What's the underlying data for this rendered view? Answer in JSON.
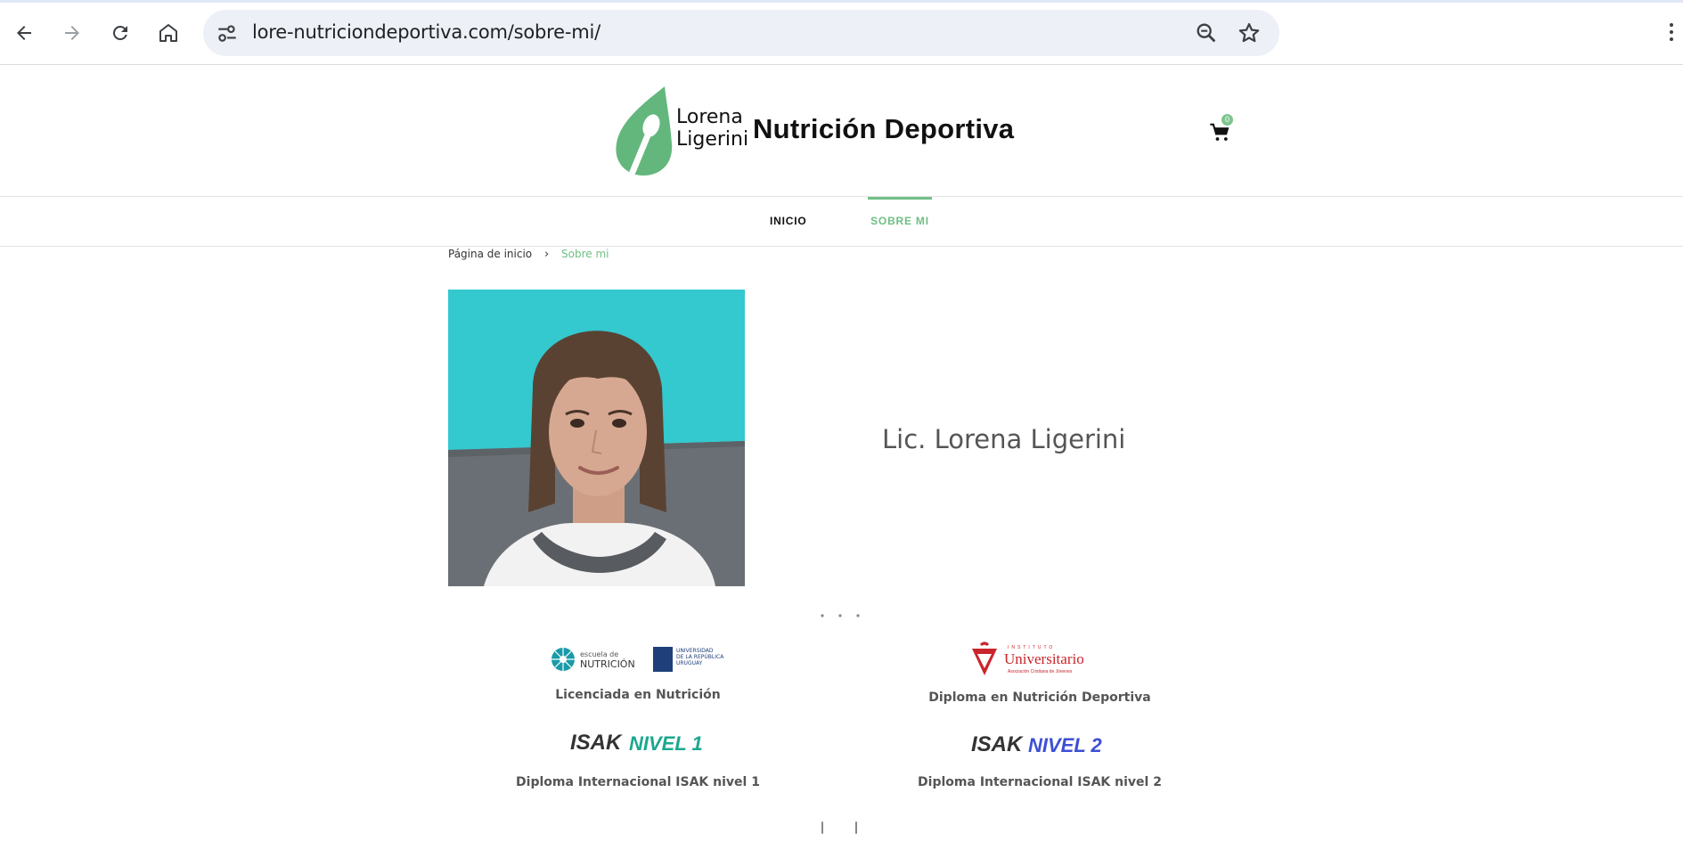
{
  "browser": {
    "url": "lore-nutriciondeportiva.com/sobre-mi/"
  },
  "site": {
    "logo_line1": "Lorena",
    "logo_line2": "Ligerini",
    "logo_title": "Nutrición Deportiva",
    "cart_count": "0",
    "brand_color": "#6fbf85"
  },
  "menu": {
    "items": [
      {
        "label": "INICIO",
        "active": false
      },
      {
        "label": "SOBRE MI",
        "active": true
      }
    ]
  },
  "breadcrumb": {
    "home": "Página de inicio",
    "separator": "›",
    "current": "Sobre mi"
  },
  "profile": {
    "name": "Lic. Lorena Ligerini"
  },
  "credentials": [
    {
      "logo_text_1": "escuela de",
      "logo_text_2": "NUTRICIÓN",
      "logo_text_3": "UNIVERSIDAD",
      "logo_text_4": "DE LA REPÚBLICA",
      "logo_text_5": "URUGUAY",
      "label": "Licenciada en Nutrición"
    },
    {
      "logo_text_1": "INSTITUTO",
      "logo_text_2": "Universitario",
      "logo_text_3": "Asociación Cristiana de Jóvenes",
      "label": "Diploma en Nutrición Deportiva"
    },
    {
      "logo_text_1": "ISAK",
      "logo_text_2": "NIVEL 1",
      "label": "Diploma Internacional ISAK nivel 1"
    },
    {
      "logo_text_1": "ISAK",
      "logo_text_2": "NIVEL 2",
      "label": "Diploma Internacional ISAK nivel 2"
    }
  ]
}
